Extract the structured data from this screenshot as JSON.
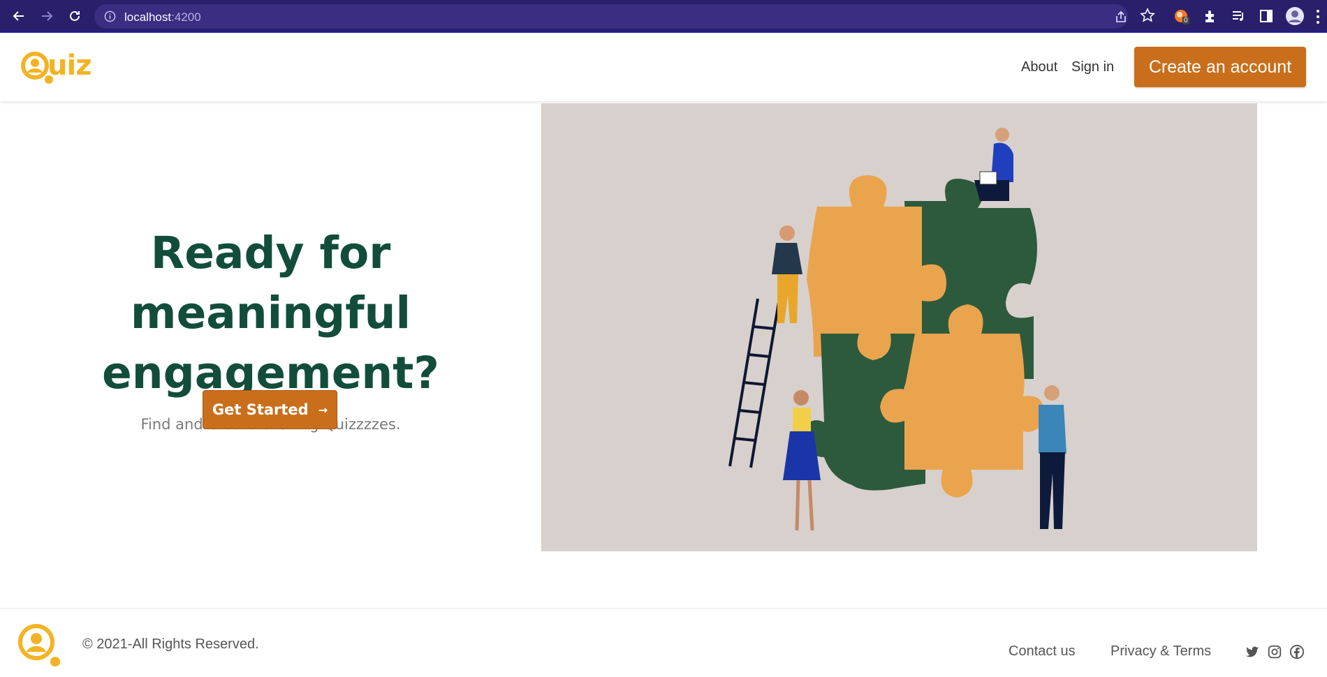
{
  "browser": {
    "url_host": "localhost",
    "url_port": ":4200",
    "extension_badge": "0"
  },
  "header": {
    "logo_text": "uiz",
    "nav": {
      "about": "About",
      "sign_in": "Sign in",
      "create_account": "Create an account"
    }
  },
  "hero": {
    "title_line1": "Ready for",
    "title_line2": "meaningful engagement?",
    "subtitle": "Find and Create exciting Quizzzzes.",
    "cta_label": "Get Started",
    "cta_icon": "→"
  },
  "footer": {
    "copyright": "© 2021-All Rights Reserved.",
    "links": {
      "contact": "Contact us",
      "privacy": "Privacy & Terms"
    },
    "social_icons": [
      "twitter-icon",
      "instagram-icon",
      "facebook-icon"
    ]
  },
  "colors": {
    "brand_orange": "#c96f1b",
    "logo_yellow": "#f3b324",
    "heading_green": "#124d3b",
    "illustration_bg": "#d8d0cc",
    "chrome_bg": "#2a1f6a"
  }
}
